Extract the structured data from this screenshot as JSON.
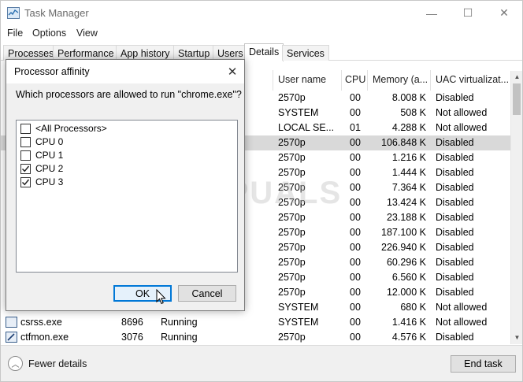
{
  "window": {
    "title": "Task Manager",
    "minimize": "—",
    "maximize": "☐",
    "close": "✕"
  },
  "menu": [
    "File",
    "Options",
    "View"
  ],
  "tabs": [
    "Processes",
    "Performance",
    "App history",
    "Startup",
    "Users",
    "Details",
    "Services"
  ],
  "table": {
    "headers": [
      "User name",
      "CPU",
      "Memory (a...",
      "UAC virtualizat..."
    ],
    "rows": [
      {
        "user": "2570p",
        "cpu": "00",
        "mem": "8.008 K",
        "uac": "Disabled"
      },
      {
        "user": "SYSTEM",
        "cpu": "00",
        "mem": "508 K",
        "uac": "Not allowed"
      },
      {
        "user": "LOCAL SE...",
        "cpu": "01",
        "mem": "4.288 K",
        "uac": "Not allowed"
      },
      {
        "user": "2570p",
        "cpu": "00",
        "mem": "106.848 K",
        "uac": "Disabled"
      },
      {
        "user": "2570p",
        "cpu": "00",
        "mem": "1.216 K",
        "uac": "Disabled"
      },
      {
        "user": "2570p",
        "cpu": "00",
        "mem": "1.444 K",
        "uac": "Disabled"
      },
      {
        "user": "2570p",
        "cpu": "00",
        "mem": "7.364 K",
        "uac": "Disabled"
      },
      {
        "user": "2570p",
        "cpu": "00",
        "mem": "13.424 K",
        "uac": "Disabled"
      },
      {
        "user": "2570p",
        "cpu": "00",
        "mem": "23.188 K",
        "uac": "Disabled"
      },
      {
        "user": "2570p",
        "cpu": "00",
        "mem": "187.100 K",
        "uac": "Disabled"
      },
      {
        "user": "2570p",
        "cpu": "00",
        "mem": "226.940 K",
        "uac": "Disabled"
      },
      {
        "user": "2570p",
        "cpu": "00",
        "mem": "60.296 K",
        "uac": "Disabled"
      },
      {
        "user": "2570p",
        "cpu": "00",
        "mem": "6.560 K",
        "uac": "Disabled"
      },
      {
        "user": "2570p",
        "cpu": "00",
        "mem": "12.000 K",
        "uac": "Disabled"
      },
      {
        "user": "SYSTEM",
        "cpu": "00",
        "mem": "680 K",
        "uac": "Not allowed"
      },
      {
        "name": "csrss.exe",
        "pid": "8696",
        "status": "Running",
        "user": "SYSTEM",
        "cpu": "00",
        "mem": "1.416 K",
        "uac": "Not allowed"
      },
      {
        "name": "ctfmon.exe",
        "pid": "3076",
        "status": "Running",
        "user": "2570p",
        "cpu": "00",
        "mem": "4.576 K",
        "uac": "Disabled"
      }
    ]
  },
  "footer": {
    "fewer_details": "Fewer details",
    "end_task": "End task"
  },
  "dialog": {
    "title": "Processor affinity",
    "question": "Which processors are allowed to run \"chrome.exe\"?",
    "options": [
      {
        "label": "<All Processors>",
        "checked": false
      },
      {
        "label": "CPU 0",
        "checked": false
      },
      {
        "label": "CPU 1",
        "checked": false
      },
      {
        "label": "CPU 2",
        "checked": true
      },
      {
        "label": "CPU 3",
        "checked": true
      }
    ],
    "ok": "OK",
    "cancel": "Cancel"
  },
  "watermark": "APPUALS"
}
